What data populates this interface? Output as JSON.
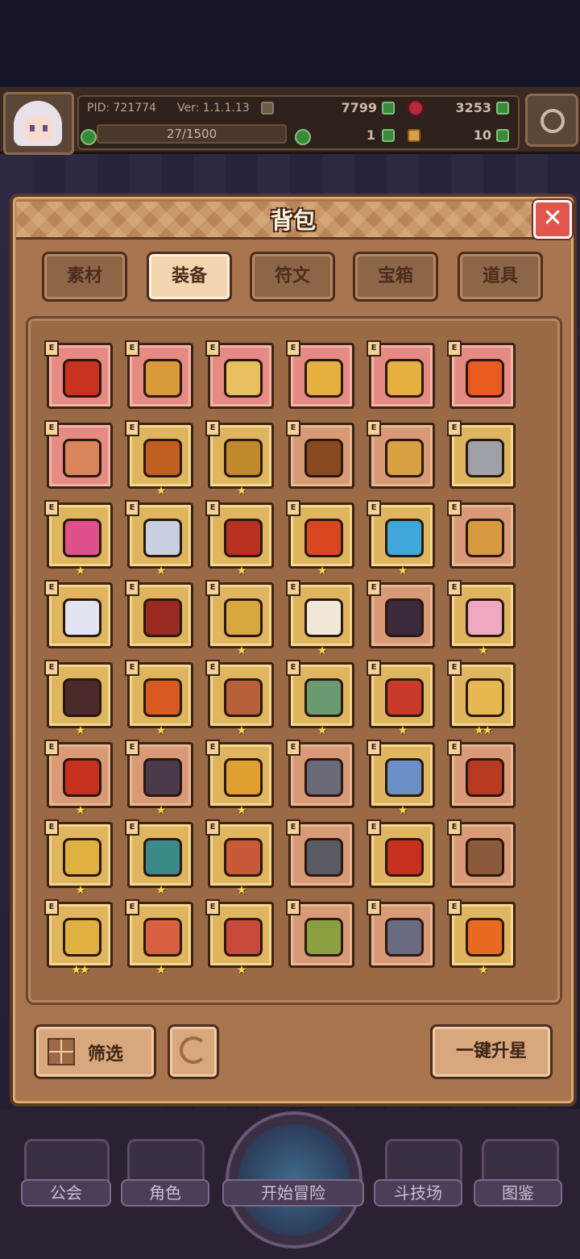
{
  "hud": {
    "pid": "PID: 721774",
    "version": "Ver: 1.1.1.13",
    "currency_1": "7799",
    "currency_2": "3253",
    "exp": "27/1500",
    "item_1": "1",
    "item_2": "10"
  },
  "modal": {
    "title": "背包",
    "tabs": [
      "素材",
      "装备",
      "符文",
      "宝箱",
      "道具"
    ],
    "active_tab": "装备",
    "e_badge": "E",
    "filter_label": "筛选",
    "upgrade_all_label": "一键升星",
    "items": [
      {
        "bg": "pink",
        "icon": "crossed-axes-icon",
        "color": "#c8321e",
        "stars": ""
      },
      {
        "bg": "pink",
        "icon": "staff-icon",
        "color": "#d99a3a",
        "stars": ""
      },
      {
        "bg": "pink",
        "icon": "straw-hat-icon",
        "color": "#e8c060",
        "stars": ""
      },
      {
        "bg": "pink",
        "icon": "heart-necklace-icon",
        "color": "#e6b040",
        "stars": ""
      },
      {
        "bg": "pink",
        "icon": "ring-icon",
        "color": "#e6b040",
        "stars": ""
      },
      {
        "bg": "pink",
        "icon": "fire-ring-icon",
        "color": "#e85a20",
        "stars": ""
      },
      {
        "bg": "pink",
        "icon": "pot-icon",
        "color": "#d9845a",
        "stars": ""
      },
      {
        "bg": "gold",
        "icon": "scepter-icon",
        "color": "#c06020",
        "stars": "★"
      },
      {
        "bg": "gold",
        "icon": "trident-icon",
        "color": "#c08a2a",
        "stars": "★"
      },
      {
        "bg": "salmon",
        "icon": "crossbow-icon",
        "color": "#8a4a20",
        "stars": ""
      },
      {
        "bg": "salmon",
        "icon": "spear-icon",
        "color": "#d8a040",
        "stars": ""
      },
      {
        "bg": "gold",
        "icon": "battle-axe-icon",
        "color": "#a0a0a8",
        "stars": ""
      },
      {
        "bg": "gold",
        "icon": "bear-doll-icon",
        "color": "#e0508a",
        "stars": "★"
      },
      {
        "bg": "gold",
        "icon": "crossed-swords-icon",
        "color": "#c8d0e0",
        "stars": "★"
      },
      {
        "bg": "gold",
        "icon": "fire-shield-icon",
        "color": "#b83020",
        "stars": "★"
      },
      {
        "bg": "gold",
        "icon": "fire-orb-icon",
        "color": "#d84820",
        "stars": "★"
      },
      {
        "bg": "gold",
        "icon": "water-orb-icon",
        "color": "#40a8d8",
        "stars": "★"
      },
      {
        "bg": "salmon",
        "icon": "arrow-icon",
        "color": "#d89a40",
        "stars": ""
      },
      {
        "bg": "gold",
        "icon": "white-orb-icon",
        "color": "#e0e4f0",
        "stars": ""
      },
      {
        "bg": "gold",
        "icon": "lava-gauntlet-icon",
        "color": "#9a2a20",
        "stars": ""
      },
      {
        "bg": "gold",
        "icon": "gold-helm-icon",
        "color": "#d8a840",
        "stars": "★"
      },
      {
        "bg": "gold",
        "icon": "winged-helm-icon",
        "color": "#f0e8d8",
        "stars": "★"
      },
      {
        "bg": "salmon",
        "icon": "cat-hood-icon",
        "color": "#3a2a3a",
        "stars": ""
      },
      {
        "bg": "gold",
        "icon": "pink-robe-icon",
        "color": "#f0a8c0",
        "stars": "★"
      },
      {
        "bg": "gold",
        "icon": "dark-armor-icon",
        "color": "#4a2a2a",
        "stars": "★"
      },
      {
        "bg": "gold",
        "icon": "flame-armor-icon",
        "color": "#d85a20",
        "stars": "★"
      },
      {
        "bg": "gold",
        "icon": "bear-armor-icon",
        "color": "#b8603a",
        "stars": "★"
      },
      {
        "bg": "gold",
        "icon": "green-cloak-icon",
        "color": "#6a9a70",
        "stars": "★"
      },
      {
        "bg": "gold",
        "icon": "royal-robe-icon",
        "color": "#c83a2a",
        "stars": "★"
      },
      {
        "bg": "gold",
        "icon": "gold-scroll-icon",
        "color": "#e8b850",
        "stars": "★★"
      },
      {
        "bg": "salmon",
        "icon": "red-scroll-icon",
        "color": "#c8301e",
        "stars": "★"
      },
      {
        "bg": "salmon",
        "icon": "dark-glove-icon",
        "color": "#4a3a4a",
        "stars": "★"
      },
      {
        "bg": "gold",
        "icon": "gold-glove-icon",
        "color": "#e0a030",
        "stars": "★"
      },
      {
        "bg": "salmon",
        "icon": "steel-glove-icon",
        "color": "#6a6a78",
        "stars": ""
      },
      {
        "bg": "gold",
        "icon": "ghost-glove-icon",
        "color": "#6a90c8",
        "stars": "★"
      },
      {
        "bg": "salmon",
        "icon": "lava-glove-icon",
        "color": "#b83a20",
        "stars": ""
      },
      {
        "bg": "gold",
        "icon": "gold-belt-icon",
        "color": "#e0b040",
        "stars": "★"
      },
      {
        "bg": "gold",
        "icon": "jewel-belt-icon",
        "color": "#3a8a8a",
        "stars": "★"
      },
      {
        "bg": "gold",
        "icon": "amulet-belt-icon",
        "color": "#c85a3a",
        "stars": "★"
      },
      {
        "bg": "salmon",
        "icon": "iron-belt-icon",
        "color": "#5a5a62",
        "stars": ""
      },
      {
        "bg": "gold",
        "icon": "fire-belt-icon",
        "color": "#c8301e",
        "stars": ""
      },
      {
        "bg": "salmon",
        "icon": "bone-belt-icon",
        "color": "#8a5a3a",
        "stars": ""
      },
      {
        "bg": "gold",
        "icon": "gold-boots-icon",
        "color": "#e0b040",
        "stars": "★★"
      },
      {
        "bg": "gold",
        "icon": "red-boots-icon",
        "color": "#d86040",
        "stars": "★"
      },
      {
        "bg": "gold",
        "icon": "royal-boots-icon",
        "color": "#c84a3a",
        "stars": "★"
      },
      {
        "bg": "salmon",
        "icon": "green-boots-icon",
        "color": "#8aa040",
        "stars": ""
      },
      {
        "bg": "salmon",
        "icon": "iron-boots-icon",
        "color": "#6a6a80",
        "stars": ""
      },
      {
        "bg": "gold",
        "icon": "fire-gem-icon",
        "color": "#e86a20",
        "stars": "★"
      }
    ]
  },
  "nav": {
    "items": [
      "公会",
      "角色",
      "开始冒险",
      "斗技场",
      "图鉴"
    ]
  }
}
